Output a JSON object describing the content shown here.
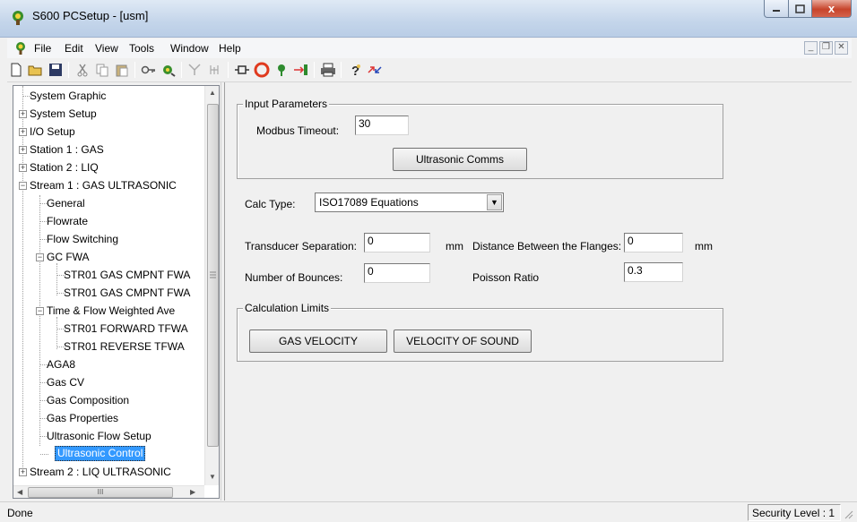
{
  "window": {
    "title": "S600 PCSetup  - [usm]",
    "controls": {
      "close": "x"
    }
  },
  "menu": {
    "items": [
      "File",
      "Edit",
      "View",
      "Tools",
      "Window",
      "Help"
    ]
  },
  "toolbar": {
    "icons": [
      "new-document-icon",
      "open-folder-icon",
      "save-icon",
      "cut-icon",
      "copy-icon",
      "paste-icon",
      "key-icon",
      "config-icon",
      "connect-icon",
      "signal-icon",
      "plug-icon",
      "stop-icon",
      "transmit-icon",
      "download-icon",
      "print-icon",
      "help-icon",
      "transfer-icon"
    ]
  },
  "tree": {
    "items": [
      {
        "label": "System Graphic",
        "level": 0,
        "expander": ""
      },
      {
        "label": "System Setup",
        "level": 0,
        "expander": "+"
      },
      {
        "label": "I/O Setup",
        "level": 0,
        "expander": "+"
      },
      {
        "label": "Station 1 : GAS",
        "level": 0,
        "expander": "+"
      },
      {
        "label": "Station 2 : LIQ",
        "level": 0,
        "expander": "+"
      },
      {
        "label": "Stream 1 : GAS ULTRASONIC",
        "level": 0,
        "expander": "-"
      },
      {
        "label": "General",
        "level": 1,
        "expander": ""
      },
      {
        "label": "Flowrate",
        "level": 1,
        "expander": ""
      },
      {
        "label": "Flow Switching",
        "level": 1,
        "expander": ""
      },
      {
        "label": "GC FWA",
        "level": 1,
        "expander": "-"
      },
      {
        "label": "STR01 GAS CMPNT FWA",
        "level": 2,
        "expander": ""
      },
      {
        "label": "STR01 GAS CMPNT FWA",
        "level": 2,
        "expander": ""
      },
      {
        "label": "Time & Flow Weighted Ave",
        "level": 1,
        "expander": "-"
      },
      {
        "label": "STR01 FORWARD TFWA",
        "level": 2,
        "expander": ""
      },
      {
        "label": "STR01 REVERSE TFWA",
        "level": 2,
        "expander": ""
      },
      {
        "label": "AGA8",
        "level": 1,
        "expander": ""
      },
      {
        "label": "Gas CV",
        "level": 1,
        "expander": ""
      },
      {
        "label": "Gas Composition",
        "level": 1,
        "expander": ""
      },
      {
        "label": "Gas Properties",
        "level": 1,
        "expander": ""
      },
      {
        "label": "Ultrasonic Flow Setup",
        "level": 1,
        "expander": ""
      },
      {
        "label": "Ultrasonic Control",
        "level": 1,
        "expander": "",
        "selected": true
      },
      {
        "label": "Stream 2 : LIQ ULTRASONIC",
        "level": 0,
        "expander": "+"
      }
    ],
    "hscroll_thumb": "III"
  },
  "form": {
    "input_group": {
      "title": "Input Parameters",
      "modbus_timeout_label": "Modbus Timeout:",
      "modbus_timeout_value": "30",
      "ultrasonic_comms_button": "Ultrasonic Comms"
    },
    "calc_type_label": "Calc Type:",
    "calc_type_value": "ISO17089 Equations",
    "transducer_separation_label": "Transducer Separation:",
    "transducer_separation_value": "0",
    "transducer_unit": "mm",
    "flange_distance_label": "Distance Between the Flanges:",
    "flange_distance_value": "0",
    "flange_unit": "mm",
    "bounces_label": "Number of Bounces:",
    "bounces_value": "0",
    "poisson_label": "Poisson Ratio",
    "poisson_value": "0.3",
    "limits_group": {
      "title": "Calculation Limits",
      "gas_velocity_button": "GAS VELOCITY",
      "velocity_of_sound_button": "VELOCITY OF SOUND"
    }
  },
  "status": {
    "left": "Done",
    "right": "Security Level : 1"
  },
  "colors": {
    "selection": "#3399ff",
    "titlebar": "#c4d5ea",
    "close_button": "#c7442b"
  }
}
